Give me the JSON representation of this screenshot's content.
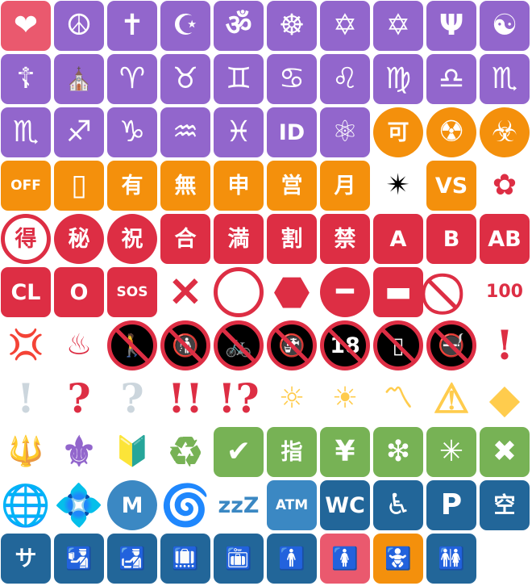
{
  "colors": {
    "purple": "#9266cc",
    "orange": "#f4900c",
    "red": "#dd2e44",
    "green": "#77b255",
    "blue": "#3b88c3",
    "darkblue": "#226699",
    "pink": "#ea596e",
    "yellow": "#ffcc4d",
    "grey": "#ccd6dd",
    "black": "#000000",
    "white": "#ffffff"
  },
  "rows": [
    [
      {
        "name": "heart-icon",
        "glyph": "❤",
        "style": "tile",
        "bg": "pink",
        "fg": "white",
        "size": "lg"
      },
      {
        "name": "peace-symbol-icon",
        "glyph": "☮",
        "style": "tile",
        "bg": "purple",
        "fg": "white",
        "size": "lg"
      },
      {
        "name": "latin-cross-icon",
        "glyph": "✝",
        "style": "tile",
        "bg": "purple",
        "fg": "white",
        "size": "lg"
      },
      {
        "name": "star-and-crescent-icon",
        "glyph": "☪",
        "style": "tile",
        "bg": "purple",
        "fg": "white",
        "size": "lg"
      },
      {
        "name": "om-icon",
        "glyph": "ॐ",
        "style": "tile",
        "bg": "purple",
        "fg": "white",
        "size": "lg"
      },
      {
        "name": "wheel-of-dharma-icon",
        "glyph": "☸",
        "style": "tile",
        "bg": "purple",
        "fg": "white",
        "size": "lg"
      },
      {
        "name": "star-of-david-icon",
        "glyph": "✡",
        "style": "tile",
        "bg": "purple",
        "fg": "white",
        "size": "lg"
      },
      {
        "name": "six-pointed-star-icon",
        "glyph": "✡",
        "style": "tile",
        "bg": "purple",
        "fg": "white",
        "size": "lg"
      },
      {
        "name": "menorah-icon",
        "glyph": "Ψ",
        "style": "tile",
        "bg": "purple",
        "fg": "white",
        "size": "lg"
      },
      {
        "name": "yin-yang-icon",
        "glyph": "☯",
        "style": "tile",
        "bg": "purple",
        "fg": "white",
        "size": "lg"
      }
    ],
    [
      {
        "name": "orthodox-cross-icon",
        "glyph": "☦",
        "style": "tile",
        "bg": "purple",
        "fg": "white",
        "size": "lg"
      },
      {
        "name": "place-of-worship-icon",
        "glyph": "⛪",
        "style": "tile",
        "bg": "purple",
        "fg": "white",
        "size": "md"
      },
      {
        "name": "aries-icon",
        "glyph": "♈",
        "style": "tile",
        "bg": "purple",
        "fg": "white",
        "size": "lg"
      },
      {
        "name": "taurus-icon",
        "glyph": "♉",
        "style": "tile",
        "bg": "purple",
        "fg": "white",
        "size": "lg"
      },
      {
        "name": "gemini-icon",
        "glyph": "♊",
        "style": "tile",
        "bg": "purple",
        "fg": "white",
        "size": "lg"
      },
      {
        "name": "cancer-icon",
        "glyph": "♋",
        "style": "tile",
        "bg": "purple",
        "fg": "white",
        "size": "lg"
      },
      {
        "name": "leo-icon",
        "glyph": "♌",
        "style": "tile",
        "bg": "purple",
        "fg": "white",
        "size": "lg"
      },
      {
        "name": "virgo-icon",
        "glyph": "♍",
        "style": "tile",
        "bg": "purple",
        "fg": "white",
        "size": "lg"
      },
      {
        "name": "libra-icon",
        "glyph": "♎",
        "style": "tile",
        "bg": "purple",
        "fg": "white",
        "size": "lg"
      },
      {
        "name": "scorpio-icon",
        "glyph": "♏",
        "style": "tile",
        "bg": "purple",
        "fg": "white",
        "size": "lg"
      }
    ],
    [
      {
        "name": "scorpio-icon",
        "glyph": "♏",
        "style": "tile",
        "bg": "purple",
        "fg": "white",
        "size": "lg"
      },
      {
        "name": "sagittarius-icon",
        "glyph": "♐",
        "style": "tile",
        "bg": "purple",
        "fg": "white",
        "size": "lg"
      },
      {
        "name": "capricorn-icon",
        "glyph": "♑",
        "style": "tile",
        "bg": "purple",
        "fg": "white",
        "size": "lg"
      },
      {
        "name": "aquarius-icon",
        "glyph": "♒",
        "style": "tile",
        "bg": "purple",
        "fg": "white",
        "size": "lg"
      },
      {
        "name": "pisces-icon",
        "glyph": "♓",
        "style": "tile",
        "bg": "purple",
        "fg": "white",
        "size": "lg"
      },
      {
        "name": "id-button-icon",
        "glyph": "ID",
        "style": "tile",
        "bg": "purple",
        "fg": "white",
        "size": "md"
      },
      {
        "name": "atom-symbol-icon",
        "glyph": "⚛",
        "style": "tile",
        "bg": "purple",
        "fg": "white",
        "size": "lg"
      },
      {
        "name": "acceptable-button-icon",
        "glyph": "可",
        "style": "circle",
        "bg": "orange",
        "fg": "white",
        "size": "md"
      },
      {
        "name": "radioactive-icon",
        "glyph": "☢",
        "style": "circle",
        "bg": "orange",
        "fg": "white",
        "size": "lg"
      },
      {
        "name": "biohazard-icon",
        "glyph": "☣",
        "style": "circle",
        "bg": "orange",
        "fg": "white",
        "size": "lg"
      }
    ],
    [
      {
        "name": "mobile-phone-off-icon",
        "glyph": "OFF",
        "style": "tile",
        "bg": "orange",
        "fg": "white",
        "size": "xs"
      },
      {
        "name": "vibration-mode-icon",
        "glyph": "▯",
        "style": "tile",
        "bg": "orange",
        "fg": "white",
        "size": "lg"
      },
      {
        "name": "not-free-of-charge-button-icon",
        "glyph": "有",
        "style": "tile",
        "bg": "orange",
        "fg": "white",
        "size": "md"
      },
      {
        "name": "free-of-charge-button-icon",
        "glyph": "無",
        "style": "tile",
        "bg": "orange",
        "fg": "white",
        "size": "md"
      },
      {
        "name": "application-button-icon",
        "glyph": "申",
        "style": "tile",
        "bg": "orange",
        "fg": "white",
        "size": "md"
      },
      {
        "name": "open-for-business-button-icon",
        "glyph": "営",
        "style": "tile",
        "bg": "orange",
        "fg": "white",
        "size": "md"
      },
      {
        "name": "monthly-amount-button-icon",
        "glyph": "月",
        "style": "tile",
        "bg": "orange",
        "fg": "white",
        "size": "md"
      },
      {
        "name": "eight-pointed-star-icon",
        "glyph": "✴",
        "style": "plain",
        "bg": "white",
        "fg": "black",
        "size": "lg"
      },
      {
        "name": "vs-button-icon",
        "glyph": "VS",
        "style": "tile",
        "bg": "orange",
        "fg": "white",
        "size": "md"
      },
      {
        "name": "white-flower-icon",
        "glyph": "✿",
        "style": "plain",
        "bg": "white",
        "fg": "red",
        "size": "lg"
      }
    ],
    [
      {
        "name": "bargain-button-icon",
        "glyph": "得",
        "style": "ring",
        "bg": "white",
        "fg": "red",
        "size": "md"
      },
      {
        "name": "secret-button-icon",
        "glyph": "秘",
        "style": "circle",
        "bg": "red",
        "fg": "white",
        "size": "md"
      },
      {
        "name": "congratulations-button-icon",
        "glyph": "祝",
        "style": "circle",
        "bg": "red",
        "fg": "white",
        "size": "md"
      },
      {
        "name": "passing-grade-button-icon",
        "glyph": "合",
        "style": "tile",
        "bg": "red",
        "fg": "white",
        "size": "md"
      },
      {
        "name": "no-vacancy-button-icon",
        "glyph": "満",
        "style": "tile",
        "bg": "red",
        "fg": "white",
        "size": "md"
      },
      {
        "name": "discount-button-icon",
        "glyph": "割",
        "style": "tile",
        "bg": "red",
        "fg": "white",
        "size": "md"
      },
      {
        "name": "prohibited-button-icon",
        "glyph": "禁",
        "style": "tile",
        "bg": "red",
        "fg": "white",
        "size": "md"
      },
      {
        "name": "a-button-icon",
        "glyph": "A",
        "style": "tile",
        "bg": "red",
        "fg": "white",
        "size": "md"
      },
      {
        "name": "b-button-icon",
        "glyph": "B",
        "style": "tile",
        "bg": "red",
        "fg": "white",
        "size": "md"
      },
      {
        "name": "ab-button-icon",
        "glyph": "AB",
        "style": "tile",
        "bg": "red",
        "fg": "white",
        "size": "md"
      }
    ],
    [
      {
        "name": "cl-button-icon",
        "glyph": "CL",
        "style": "tile",
        "bg": "red",
        "fg": "white",
        "size": "md"
      },
      {
        "name": "o-button-icon",
        "glyph": "O",
        "style": "tile",
        "bg": "red",
        "fg": "white",
        "size": "md"
      },
      {
        "name": "sos-button-icon",
        "glyph": "SOS",
        "style": "tile",
        "bg": "red",
        "fg": "white",
        "size": "xs"
      },
      {
        "name": "cross-mark-icon",
        "glyph": "✕",
        "style": "plain",
        "bg": "white",
        "fg": "red",
        "size": "ex"
      },
      {
        "name": "hollow-red-circle-icon",
        "glyph": "",
        "style": "ring",
        "bg": "white",
        "fg": "red",
        "size": "lg"
      },
      {
        "name": "stop-sign-icon",
        "glyph": "⬣",
        "style": "plain",
        "bg": "white",
        "fg": "red",
        "size": "ex"
      },
      {
        "name": "no-entry-icon",
        "glyph": "━",
        "style": "circle",
        "bg": "red",
        "fg": "white",
        "size": "lg"
      },
      {
        "name": "name-badge-icon",
        "glyph": "▬",
        "style": "tile",
        "bg": "red",
        "fg": "white",
        "size": "lg"
      },
      {
        "name": "prohibited-icon",
        "glyph": "⃠",
        "style": "plain",
        "bg": "white",
        "fg": "red",
        "size": "ex"
      },
      {
        "name": "hundred-points-icon",
        "glyph": "100",
        "style": "plain",
        "bg": "white",
        "fg": "red",
        "size": "sm"
      }
    ],
    [
      {
        "name": "anger-symbol-icon",
        "glyph": "💢",
        "style": "plain",
        "bg": "white",
        "fg": "red",
        "size": "lg"
      },
      {
        "name": "hot-springs-icon",
        "glyph": "♨",
        "style": "plain",
        "bg": "white",
        "fg": "red",
        "size": "lg"
      },
      {
        "name": "no-pedestrians-icon",
        "glyph": "🚶",
        "style": "nosign",
        "bg": "black",
        "fg": "white",
        "size": "md"
      },
      {
        "name": "no-littering-icon",
        "glyph": "🚯",
        "style": "nosign",
        "bg": "black",
        "fg": "white",
        "size": "md"
      },
      {
        "name": "no-bicycles-icon",
        "glyph": "🚲",
        "style": "nosign",
        "bg": "black",
        "fg": "white",
        "size": "md"
      },
      {
        "name": "non-potable-water-icon",
        "glyph": "🚱",
        "style": "nosign",
        "bg": "black",
        "fg": "white",
        "size": "md"
      },
      {
        "name": "no-one-under-eighteen-icon",
        "glyph": "18",
        "style": "nosign",
        "bg": "black",
        "fg": "white",
        "size": "md"
      },
      {
        "name": "no-mobile-phones-icon",
        "glyph": "▯",
        "style": "nosign",
        "bg": "black",
        "fg": "white",
        "size": "md"
      },
      {
        "name": "no-smoking-icon",
        "glyph": "🚭",
        "style": "nosign",
        "bg": "black",
        "fg": "white",
        "size": "md"
      },
      {
        "name": "exclamation-mark-icon",
        "glyph": "!",
        "style": "plain",
        "bg": "white",
        "fg": "red",
        "size": "ex"
      }
    ],
    [
      {
        "name": "white-exclamation-mark-icon",
        "glyph": "!",
        "style": "plain",
        "bg": "white",
        "fg": "grey",
        "size": "ex"
      },
      {
        "name": "question-mark-icon",
        "glyph": "?",
        "style": "plain",
        "bg": "white",
        "fg": "red",
        "size": "ex"
      },
      {
        "name": "white-question-mark-icon",
        "glyph": "?",
        "style": "plain",
        "bg": "white",
        "fg": "grey",
        "size": "ex"
      },
      {
        "name": "double-exclamation-mark-icon",
        "glyph": "!!",
        "style": "plain",
        "bg": "white",
        "fg": "red",
        "size": "ex"
      },
      {
        "name": "exclamation-question-mark-icon",
        "glyph": "!?",
        "style": "plain",
        "bg": "white",
        "fg": "red",
        "size": "ex"
      },
      {
        "name": "dim-button-icon",
        "glyph": "☼",
        "style": "plain",
        "bg": "white",
        "fg": "yellow",
        "size": "lg"
      },
      {
        "name": "bright-button-icon",
        "glyph": "☀",
        "style": "plain",
        "bg": "white",
        "fg": "yellow",
        "size": "lg"
      },
      {
        "name": "part-alternation-mark-icon",
        "glyph": "〽",
        "style": "plain",
        "bg": "white",
        "fg": "yellow",
        "size": "lg"
      },
      {
        "name": "warning-icon",
        "glyph": "⚠",
        "style": "plain",
        "bg": "white",
        "fg": "yellow",
        "size": "ex"
      },
      {
        "name": "children-crossing-icon",
        "glyph": "◆",
        "style": "plain",
        "bg": "white",
        "fg": "yellow",
        "size": "ex"
      }
    ],
    [
      {
        "name": "trident-emblem-icon",
        "glyph": "🔱",
        "style": "plain",
        "bg": "white",
        "fg": "yellow",
        "size": "lg"
      },
      {
        "name": "fleur-de-lis-icon",
        "glyph": "⚜",
        "style": "plain",
        "bg": "white",
        "fg": "purple",
        "size": "ex"
      },
      {
        "name": "japanese-beginner-symbol-icon",
        "glyph": "🔰",
        "style": "plain",
        "bg": "white",
        "fg": "green",
        "size": "lg"
      },
      {
        "name": "recycling-symbol-icon",
        "glyph": "♻",
        "style": "plain",
        "bg": "white",
        "fg": "green",
        "size": "ex"
      },
      {
        "name": "check-mark-button-icon",
        "glyph": "✔",
        "style": "tile",
        "bg": "green",
        "fg": "white",
        "size": "lg"
      },
      {
        "name": "reserved-button-icon",
        "glyph": "指",
        "style": "tile",
        "bg": "green",
        "fg": "white",
        "size": "md"
      },
      {
        "name": "chart-increasing-with-yen-icon",
        "glyph": "¥",
        "style": "tile",
        "bg": "green",
        "fg": "white",
        "size": "lg"
      },
      {
        "name": "sparkle-icon",
        "glyph": "❇",
        "style": "tile",
        "bg": "green",
        "fg": "white",
        "size": "lg"
      },
      {
        "name": "eight-spoked-asterisk-icon",
        "glyph": "✳",
        "style": "tile",
        "bg": "green",
        "fg": "white",
        "size": "lg"
      },
      {
        "name": "cross-mark-button-icon",
        "glyph": "✖",
        "style": "tile",
        "bg": "green",
        "fg": "white",
        "size": "lg"
      }
    ],
    [
      {
        "name": "globe-with-meridians-icon",
        "glyph": "🌐",
        "style": "plain",
        "bg": "white",
        "fg": "blue",
        "size": "ex"
      },
      {
        "name": "diamond-with-a-dot-icon",
        "glyph": "💠",
        "style": "plain",
        "bg": "white",
        "fg": "blue",
        "size": "ex"
      },
      {
        "name": "circled-m-icon",
        "glyph": "M",
        "style": "circle",
        "bg": "blue",
        "fg": "white",
        "size": "md"
      },
      {
        "name": "cyclone-icon",
        "glyph": "🌀",
        "style": "plain",
        "bg": "white",
        "fg": "blue",
        "size": "ex"
      },
      {
        "name": "zzz-icon",
        "glyph": "zzZ",
        "style": "plain",
        "bg": "white",
        "fg": "blue",
        "size": "md"
      },
      {
        "name": "atm-sign-icon",
        "glyph": "ATM",
        "style": "tile",
        "bg": "blue",
        "fg": "white",
        "size": "xs"
      },
      {
        "name": "water-closet-icon",
        "glyph": "WC",
        "style": "tile",
        "bg": "darkblue",
        "fg": "white",
        "size": "md"
      },
      {
        "name": "wheelchair-symbol-icon",
        "glyph": "♿",
        "style": "tile",
        "bg": "darkblue",
        "fg": "white",
        "size": "lg"
      },
      {
        "name": "p-button-icon",
        "glyph": "P",
        "style": "tile",
        "bg": "darkblue",
        "fg": "white",
        "size": "lg"
      },
      {
        "name": "vacancy-button-icon",
        "glyph": "空",
        "style": "tile",
        "bg": "darkblue",
        "fg": "white",
        "size": "md"
      }
    ],
    [
      {
        "name": "service-charge-button-icon",
        "glyph": "サ",
        "style": "tile",
        "bg": "darkblue",
        "fg": "white",
        "size": "md"
      },
      {
        "name": "passport-control-icon",
        "glyph": "🛂",
        "style": "tile",
        "bg": "darkblue",
        "fg": "white",
        "size": "md"
      },
      {
        "name": "customs-icon",
        "glyph": "🛃",
        "style": "tile",
        "bg": "darkblue",
        "fg": "white",
        "size": "md"
      },
      {
        "name": "baggage-claim-icon",
        "glyph": "🛄",
        "style": "tile",
        "bg": "darkblue",
        "fg": "white",
        "size": "md"
      },
      {
        "name": "left-luggage-icon",
        "glyph": "🛅",
        "style": "tile",
        "bg": "darkblue",
        "fg": "white",
        "size": "md"
      },
      {
        "name": "mens-room-icon",
        "glyph": "🚹",
        "style": "tile",
        "bg": "darkblue",
        "fg": "white",
        "size": "md"
      },
      {
        "name": "womens-room-icon",
        "glyph": "🚺",
        "style": "tile",
        "bg": "pink",
        "fg": "white",
        "size": "md"
      },
      {
        "name": "baby-symbol-icon",
        "glyph": "🚼",
        "style": "tile",
        "bg": "orange",
        "fg": "white",
        "size": "md"
      },
      {
        "name": "restroom-icon",
        "glyph": "🚻",
        "style": "tile",
        "bg": "darkblue",
        "fg": "white",
        "size": "md"
      }
    ]
  ]
}
